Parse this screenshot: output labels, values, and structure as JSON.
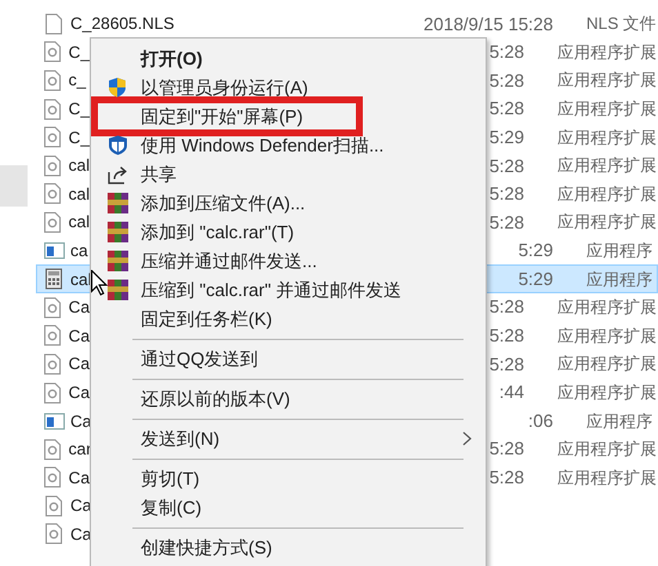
{
  "file_list": {
    "rows": [
      {
        "kind": "doc",
        "name": "C_28605.NLS",
        "modified": "2018/9/15 15:28",
        "type": "NLS 文件",
        "selected": false
      },
      {
        "kind": "ext",
        "name": "C_",
        "modified": "5:28",
        "type": "应用程序扩展",
        "selected": false
      },
      {
        "kind": "ext",
        "name": "c_",
        "modified": "5:28",
        "type": "应用程序扩展",
        "selected": false
      },
      {
        "kind": "ext",
        "name": "C_",
        "modified": "5:28",
        "type": "应用程序扩展",
        "selected": false
      },
      {
        "kind": "ext",
        "name": "C_",
        "modified": "5:29",
        "type": "应用程序扩展",
        "selected": false
      },
      {
        "kind": "ext",
        "name": "cal",
        "modified": "5:28",
        "type": "应用程序扩展",
        "selected": false
      },
      {
        "kind": "ext",
        "name": "cal",
        "modified": "5:28",
        "type": "应用程序扩展",
        "selected": false
      },
      {
        "kind": "ext",
        "name": "cal",
        "modified": "5:28",
        "type": "应用程序扩展",
        "selected": false
      },
      {
        "kind": "window",
        "name": "ca",
        "modified": "5:29",
        "type": "应用程序",
        "selected": false
      },
      {
        "kind": "calculator",
        "name": "cal",
        "modified": "5:29",
        "type": "应用程序",
        "selected": true
      },
      {
        "kind": "ext",
        "name": "Ca",
        "modified": "5:28",
        "type": "应用程序扩展",
        "selected": false
      },
      {
        "kind": "ext",
        "name": "Ca",
        "modified": "5:28",
        "type": "应用程序扩展",
        "selected": false
      },
      {
        "kind": "ext",
        "name": "Ca",
        "modified": "5:28",
        "type": "应用程序扩展",
        "selected": false
      },
      {
        "kind": "ext",
        "name": "Ca",
        "modified": ":44",
        "type": "应用程序扩展",
        "selected": false
      },
      {
        "kind": "window",
        "name": "Ca",
        "modified": ":06",
        "type": "应用程序",
        "selected": false
      },
      {
        "kind": "ext",
        "name": "car",
        "modified": "5:28",
        "type": "应用程序扩展",
        "selected": false
      },
      {
        "kind": "ext",
        "name": "Ca",
        "modified": "5:28",
        "type": "应用程序扩展",
        "selected": false
      },
      {
        "kind": "ext",
        "name": "Ca",
        "selected": false
      },
      {
        "kind": "ext",
        "name": "Ca",
        "selected": false
      }
    ]
  },
  "context_menu": {
    "items": [
      {
        "kind": "default",
        "label": "打开(O)",
        "highlighted": false
      },
      {
        "kind": "shield",
        "label": "以管理员身份运行(A)",
        "highlighted": false
      },
      {
        "kind": "plain",
        "label": "固定到\"开始\"屏幕(P)",
        "highlighted": true
      },
      {
        "kind": "defender",
        "label": "使用 Windows Defender扫描...",
        "highlighted": false
      },
      {
        "kind": "share",
        "label": "共享",
        "highlighted": false
      },
      {
        "kind": "archive",
        "label": "添加到压缩文件(A)...",
        "highlighted": false
      },
      {
        "kind": "archive",
        "label": "添加到 \"calc.rar\"(T)",
        "highlighted": false
      },
      {
        "kind": "archive",
        "label": "压缩并通过邮件发送...",
        "highlighted": false
      },
      {
        "kind": "archive",
        "label": "压缩到 \"calc.rar\" 并通过邮件发送",
        "highlighted": false
      },
      {
        "kind": "plain",
        "label": "固定到任务栏(K)",
        "highlighted": false
      },
      {
        "kind": "separator"
      },
      {
        "kind": "plain",
        "label": "通过QQ发送到",
        "highlighted": false
      },
      {
        "kind": "separator"
      },
      {
        "kind": "plain",
        "label": "还原以前的版本(V)",
        "highlighted": false
      },
      {
        "kind": "separator"
      },
      {
        "kind": "submenu",
        "label": "发送到(N)",
        "highlighted": false
      },
      {
        "kind": "separator"
      },
      {
        "kind": "plain",
        "label": "剪切(T)",
        "highlighted": false
      },
      {
        "kind": "plain",
        "label": "复制(C)",
        "highlighted": false
      },
      {
        "kind": "separator"
      },
      {
        "kind": "plain",
        "label": "创建快捷方式(S)",
        "highlighted": false
      }
    ]
  }
}
